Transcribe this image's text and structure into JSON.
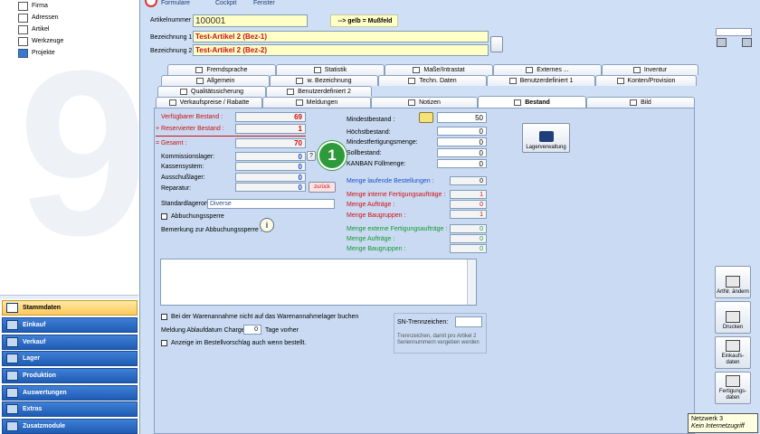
{
  "nav": {
    "tree_items": [
      "Firma",
      "Adressen",
      "Artikel",
      "Werkzeuge",
      "Projekte"
    ],
    "watermark": "9",
    "modules": [
      {
        "label": "Stammdaten",
        "selected": true
      },
      {
        "label": "Einkauf",
        "selected": false
      },
      {
        "label": "Verkauf",
        "selected": false
      },
      {
        "label": "Lager",
        "selected": false
      },
      {
        "label": "Produktion",
        "selected": false
      },
      {
        "label": "Auswertungen",
        "selected": false
      },
      {
        "label": "Extras",
        "selected": false
      },
      {
        "label": "Zusatzmodule",
        "selected": false
      }
    ]
  },
  "menu": {
    "items": [
      "Formulare",
      "Cockpit",
      "Fenster"
    ]
  },
  "header": {
    "artikelnummer_label": "Artikelnummer :",
    "artikelnummer_value": "100001",
    "hint": "--> gelb = Mußfeld",
    "bez1_label": "Bezeichnung 1 :",
    "bez1_value": "Test-Artikel 2  (Bez-1)",
    "bez2_label": "Bezeichnung 2 :",
    "bez2_value": "Test-Artikel 2  (Bez-2)"
  },
  "tabs": {
    "row1": [
      "Fremdsprache",
      "Statistik",
      "Maße/Intrastat",
      "Externes ...",
      "Inventur"
    ],
    "row2": [
      "Allgemein",
      "w. Bezeichnung",
      "Techn. Daten",
      "Benutzerdefiniert 1",
      "Konten/Provision"
    ],
    "row3": [
      "Qualitätssicherung",
      "Benutzerdefiniert 2"
    ],
    "row4": [
      "Verkaufspreise / Rabatte",
      "Meldungen",
      "Notizen",
      "Bestand",
      "Bild"
    ],
    "active": "Bestand"
  },
  "bestand": {
    "verfuegbar_label": "Verfügbarer Bestand :",
    "verfuegbar_value": "69",
    "reserviert_label": "+  Reservierter Bestand :",
    "reserviert_value": "1",
    "gesamt_label": "=  Gesamt :",
    "gesamt_value": "70",
    "kommission_label": "Kommissionslager:",
    "kommission_value": "0",
    "kassen_label": "Kassensystem:",
    "kassen_value": "0",
    "ausschuss_label": "Ausschußlager:",
    "ausschuss_value": "0",
    "reparatur_label": "Reparatur:",
    "reparatur_value": "0",
    "question_label": "?",
    "zurueck_label": "zurück",
    "standard_label": "Standardlagerort :",
    "standard_value": "Diverse",
    "abbuchungssperre_label": "Abbuchungssperre",
    "bemerkung_label": "Bemerkung zur Abbuchungssperre :",
    "mindest_label": "Mindestbestand :",
    "mindest_value": "50",
    "hoechst_label": "Höchstbestand:",
    "hoechst_value": "0",
    "mindestfert_label": "Mindestfertigungsmenge:",
    "mindestfert_value": "0",
    "sollbestand_label": "Sollbestand:",
    "sollbestand_value": "0",
    "kanban_label": "KANBAN Füllmenge:",
    "kanban_value": "0",
    "lager_button": "Lagerverwaltung",
    "callout": "1",
    "laufende_label": "Menge laufende Bestellungen :",
    "laufende_value": "0",
    "interne_label": "Menge interne Fertigungsaufträge :",
    "interne_value": "1",
    "auftraege_label": "Menge Aufträge :",
    "auftraege_value": "0",
    "baugruppen_label": "Menge Baugruppen :",
    "baugruppen_value": "1",
    "externe_label": "Menge externe Fertigungsaufträge :",
    "externe_value": "0",
    "auftraege2_label": "Menge Aufträge :",
    "auftraege2_value": "0",
    "baugruppen2_label": "Menge Baugruppen :",
    "baugruppen2_value": "0",
    "wareneingang_label": "Bei der Warenannahme nicht auf das Warenannahmelager buchen",
    "meldung_label": "Meldung Ablaufdatum Chargen",
    "meldung_value": "0",
    "tage_label": "Tage vorher",
    "anzeige_label": "Anzeige im Bestellvorschlag auch wenn bestellt.",
    "sn_label": "SN-Trennzeichen:",
    "sn_hint": "Trennzeichen, damit pro Artikel 2 Seriennummern vergeben werden"
  },
  "rightbar": {
    "buttons": [
      "ArtNr. ändern",
      "Drucken",
      "Einkaufs-daten",
      "Fertigungs-daten"
    ]
  },
  "tooltip": {
    "line1": "Netzwerk 3",
    "line2": "Kein Internetzugriff"
  },
  "colors": {
    "nav_blue": "#1f5cb5",
    "selected": "#ffc95a",
    "mandatory": "#ffffc6",
    "red": "#d01010",
    "green": "#149a34",
    "callout": "#2e9a3a"
  }
}
